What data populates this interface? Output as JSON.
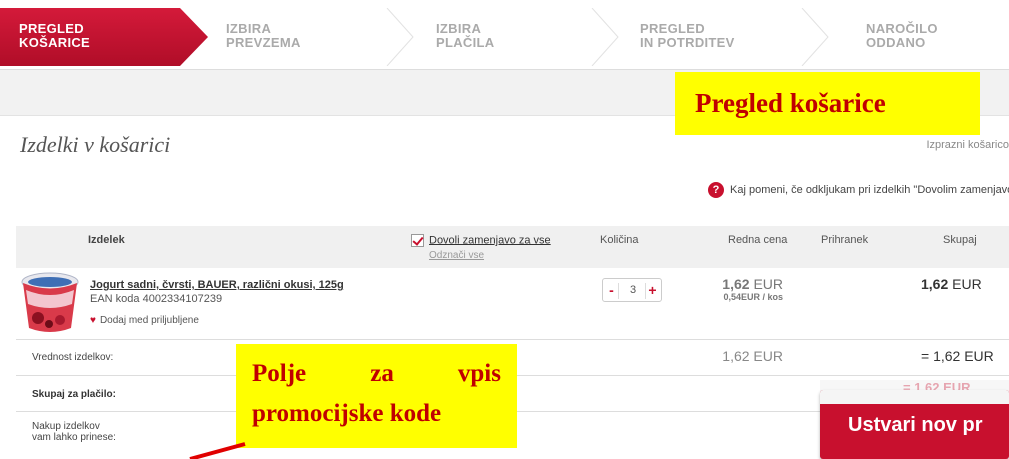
{
  "steps": [
    {
      "line1": "PREGLED",
      "line2": "KOŠARICE",
      "active": true
    },
    {
      "line1": "IZBIRA",
      "line2": "PREVZEMA",
      "active": false
    },
    {
      "line1": "IZBIRA",
      "line2": "PLAČILA",
      "active": false
    },
    {
      "line1": "PREGLED",
      "line2": "IN POTRDITEV",
      "active": false
    },
    {
      "line1": "NAROČILO",
      "line2": "ODDANO",
      "active": false
    }
  ],
  "callouts": {
    "top": "Pregled košarice",
    "mid": "Polje za vpis promocijske kode"
  },
  "section_title": "Izdelki v košarici",
  "empty_cart_link": "Izprazni košarico",
  "help_text": "Kaj pomeni, če odkljukam pri izdelkih \"Dovolim zamenjavo\"",
  "table_header": {
    "product": "Izdelek",
    "allow_replace_all": "Dovoli zamenjavo za vse",
    "unmark": "Odznači vse",
    "quantity": "Količina",
    "regular_price": "Redna cena",
    "saving": "Prihranek",
    "total": "Skupaj"
  },
  "product": {
    "name": "Jogurt sadni, čvrsti, BAUER, različni okusi, 125g",
    "ean": "EAN koda 4002334107239",
    "add_favorite": "Dodaj med priljubljene",
    "quantity": "3",
    "price_value": "1,62",
    "price_currency": "EUR",
    "unit_price": "0,54EUR / kos",
    "total_value": "1,62",
    "total_currency": "EUR"
  },
  "summary": {
    "value_label": "Vrednost izdelkov:",
    "value_price": "1,62 EUR",
    "value_total": "= 1,62 EUR",
    "pay_label": "Skupaj za plačilo:",
    "buy_label_line1": "Nakup izdelkov",
    "buy_label_line2": "vam lahko prinese:"
  },
  "cta_button": "Ustvari nov pr",
  "colors": {
    "accent": "#c8102e",
    "highlight": "#ffff00",
    "callout_text": "#c00000"
  }
}
